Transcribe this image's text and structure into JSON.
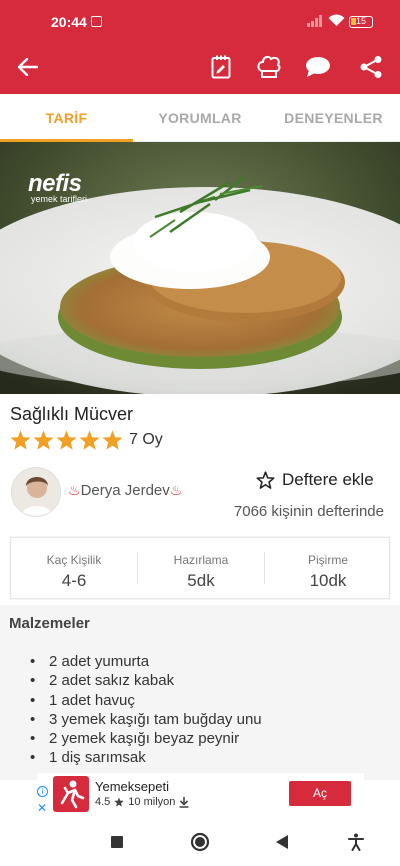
{
  "status": {
    "time": "20:44",
    "battery": "15"
  },
  "tabs": [
    {
      "label": "TARİF",
      "active": true
    },
    {
      "label": "YORUMLAR",
      "active": false
    },
    {
      "label": "DENEYENLER",
      "active": false
    }
  ],
  "hero": {
    "logo_big": "nefis",
    "logo_small": "yemek tarifleri"
  },
  "recipe": {
    "title": "Sağlıklı Mücver",
    "rating": 5,
    "votes": "7 Oy"
  },
  "author": {
    "name": "Derya Jerdev",
    "flame": "♨",
    "add_label": "Deftere ekle",
    "bookmark_count": "7066 kişinin defterinde"
  },
  "info": [
    {
      "label": "Kaç Kişilik",
      "value": "4-6"
    },
    {
      "label": "Hazırlama",
      "value": "5dk"
    },
    {
      "label": "Pişirme",
      "value": "10dk"
    }
  ],
  "ingredients": {
    "title": "Malzemeler",
    "items": [
      "2 adet yumurta",
      "2 adet sakız kabak",
      "1 adet havuç",
      "3 yemek kaşığı  tam buğday unu",
      "2 yemek kaşığı beyaz peynir",
      "1 diş sarımsak"
    ]
  },
  "ad": {
    "name": "Yemeksepeti",
    "rating": "4.5",
    "downloads": "10 milyon",
    "button": "Aç",
    "info_icon": "i"
  },
  "colors": {
    "primary": "#d62b3d",
    "accent": "#f1a026",
    "star": "#f1a026"
  }
}
